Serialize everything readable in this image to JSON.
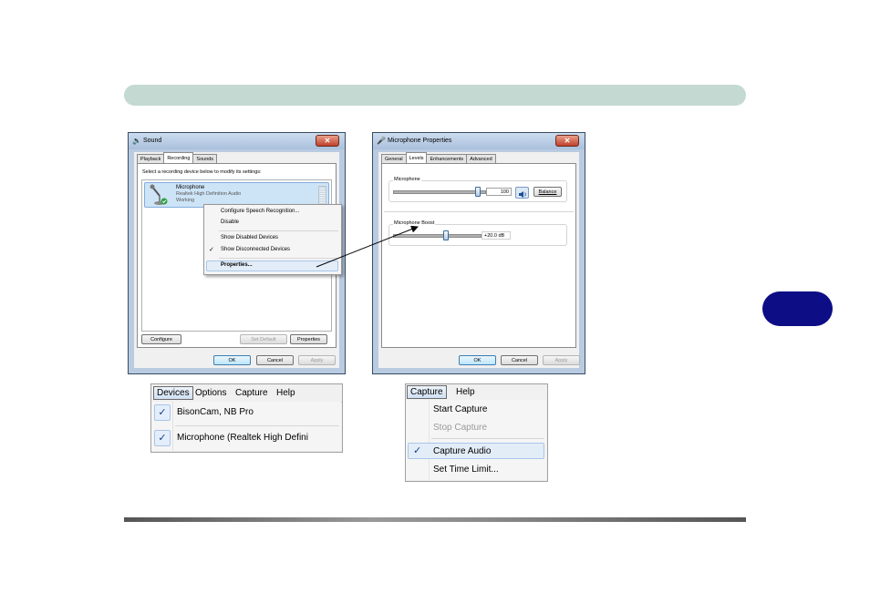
{
  "page": {
    "side_tab_label": ""
  },
  "sound_window": {
    "title": "Sound",
    "tabs": [
      "Playback",
      "Recording",
      "Sounds"
    ],
    "active_tab": "Recording",
    "instruction": "Select a recording device below to modify its settings:",
    "device": {
      "name": "Microphone",
      "description": "Realtek High Definition Audio",
      "status": "Working"
    },
    "buttons": {
      "configure": "Configure",
      "set_default": "Set Default",
      "properties": "Properties",
      "ok": "OK",
      "cancel": "Cancel",
      "apply": "Apply"
    },
    "context_menu": {
      "items": [
        "Configure Speech Recognition...",
        "Disable",
        "Show Disabled Devices",
        "Show Disconnected Devices",
        "Properties..."
      ],
      "checked_item": "Show Disconnected Devices"
    }
  },
  "mic_properties_window": {
    "title": "Microphone Properties",
    "tabs": [
      "General",
      "Levels",
      "Enhancements",
      "Advanced"
    ],
    "active_tab": "Levels",
    "microphone": {
      "label": "Microphone",
      "value": "100",
      "level_fraction": 0.92,
      "balance_button": "Balance"
    },
    "boost": {
      "label": "Microphone Boost",
      "value": "+20.0 dB",
      "level_fraction": 0.6
    },
    "buttons": {
      "ok": "OK",
      "cancel": "Cancel",
      "apply": "Apply"
    }
  },
  "devices_menu": {
    "menubar": [
      "Devices",
      "Options",
      "Capture",
      "Help"
    ],
    "open_menu": "Devices",
    "items": [
      {
        "label": "BisonCam, NB Pro",
        "checked": true
      },
      {
        "label": "Microphone (Realtek High Defini",
        "checked": true
      }
    ]
  },
  "capture_menu": {
    "menubar": [
      "Capture",
      "Help"
    ],
    "open_menu": "Capture",
    "items": [
      {
        "label": "Start Capture",
        "enabled": true,
        "checked": false
      },
      {
        "label": "Stop Capture",
        "enabled": false,
        "checked": false
      },
      {
        "label": "Capture Audio",
        "enabled": true,
        "checked": true
      },
      {
        "label": "Set Time Limit...",
        "enabled": true,
        "checked": false
      }
    ]
  },
  "colors": {
    "header_bar": "#c5d9d3",
    "side_tab": "#0d0d86",
    "window_frame": "#b9cbe1",
    "selection": "#cde4f7"
  },
  "icons": {
    "check": "✓",
    "close": "✕",
    "speaker": "speaker-icon",
    "microphone": "microphone-icon"
  }
}
